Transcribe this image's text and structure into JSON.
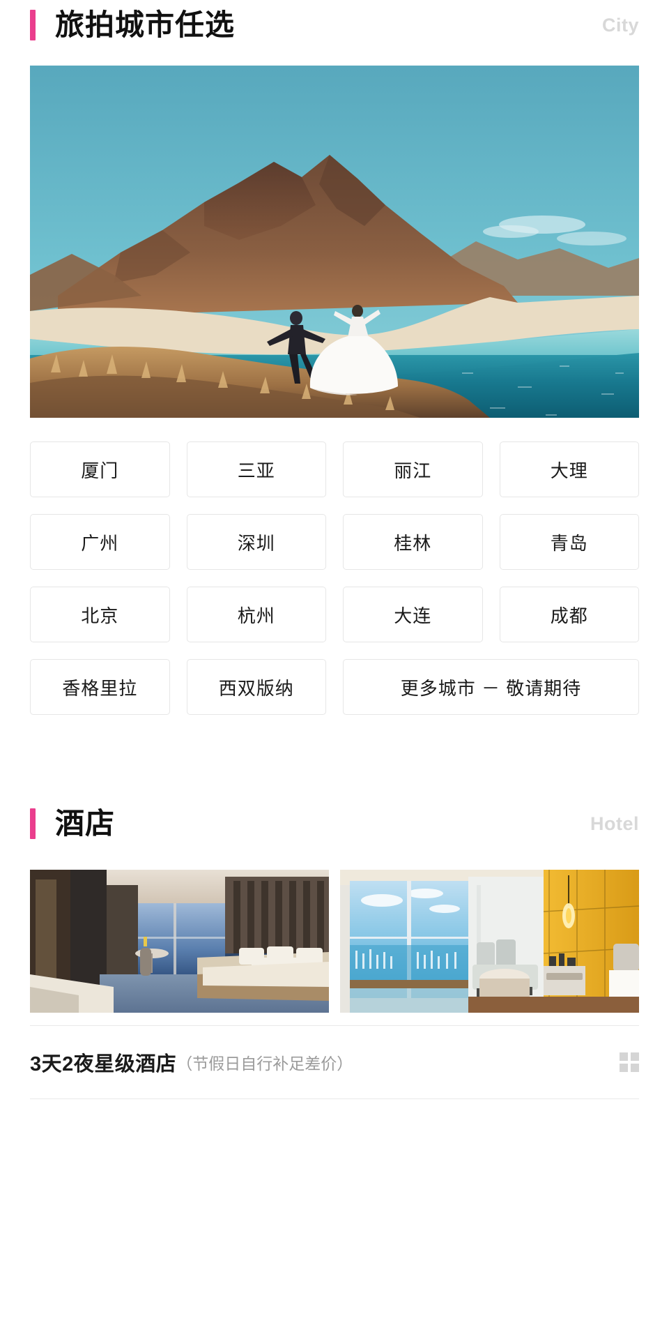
{
  "sections": [
    {
      "id": "city",
      "accent_color": "#ea3e8d",
      "title": "旅拍城市任选",
      "subtitle": "City",
      "hero": {
        "alt": "海岛山峰与婚纱情侣旅拍照",
        "icon": "hero-photo"
      },
      "cities": [
        {
          "label": "厦门",
          "wide": false
        },
        {
          "label": "三亚",
          "wide": false
        },
        {
          "label": "丽江",
          "wide": false
        },
        {
          "label": "大理",
          "wide": false
        },
        {
          "label": "广州",
          "wide": false
        },
        {
          "label": "深圳",
          "wide": false
        },
        {
          "label": "桂林",
          "wide": false
        },
        {
          "label": "青岛",
          "wide": false
        },
        {
          "label": "北京",
          "wide": false
        },
        {
          "label": "杭州",
          "wide": false
        },
        {
          "label": "大连",
          "wide": false
        },
        {
          "label": "成都",
          "wide": false
        },
        {
          "label": "香格里拉",
          "wide": false
        },
        {
          "label": "西双版纳",
          "wide": false
        },
        {
          "label": "更多城市 － 敬请期待",
          "wide": true
        }
      ]
    },
    {
      "id": "hotel",
      "accent_color": "#ea3e8d",
      "title": "酒店",
      "subtitle": "Hotel",
      "photos": [
        {
          "alt": "海景套房大床房",
          "icon": "hotel-room-photo"
        },
        {
          "alt": "黄色调落地窗客房",
          "icon": "hotel-room-photo"
        }
      ],
      "caption": {
        "main": "3天2夜星级酒店",
        "note": "（节假日自行补足差价）",
        "grid_icon": "grid-icon"
      }
    }
  ]
}
